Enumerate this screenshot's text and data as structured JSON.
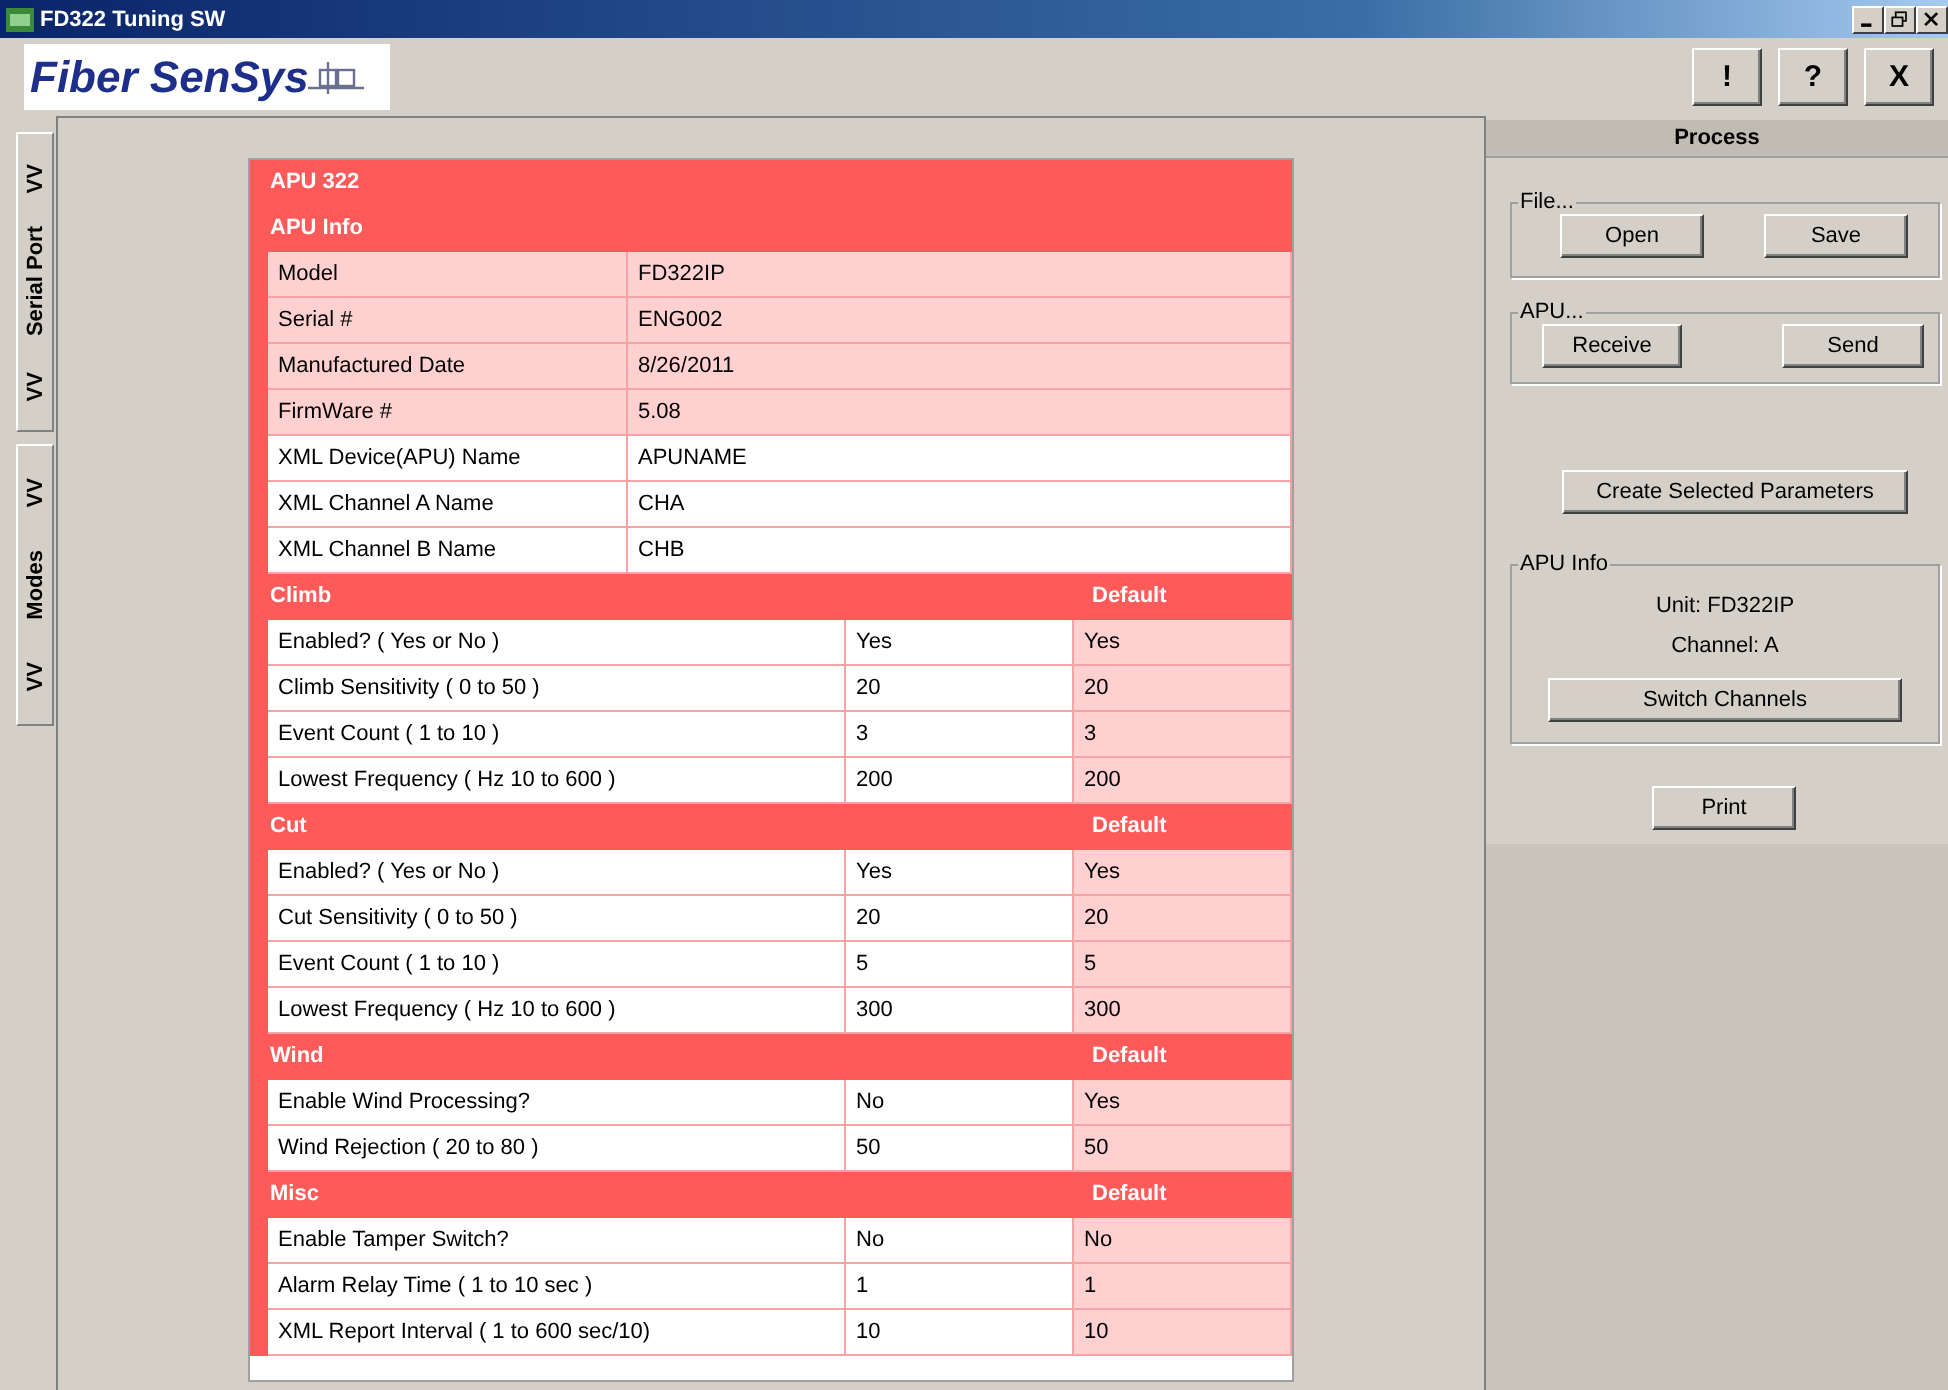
{
  "window": {
    "title": "FD322 Tuning SW"
  },
  "toolbar": {
    "logo": "Fiber SenSys",
    "buttons": [
      "!",
      "?",
      "X"
    ]
  },
  "side_tabs": [
    {
      "lead": "VV",
      "label": "Serial Port",
      "trail": "VV"
    },
    {
      "lead": "VV",
      "label": "Modes",
      "trail": "VV"
    }
  ],
  "sheet": {
    "title": "APU 322",
    "info": {
      "heading": "APU Info",
      "rows": [
        {
          "label": "Model",
          "value": "FD322IP",
          "editable": false
        },
        {
          "label": "Serial #",
          "value": "ENG002",
          "editable": false
        },
        {
          "label": "Manufactured Date",
          "value": "8/26/2011",
          "editable": false
        },
        {
          "label": "FirmWare #",
          "value": "5.08",
          "editable": false
        },
        {
          "label": "XML Device(APU) Name",
          "value": "APUNAME",
          "editable": true
        },
        {
          "label": "XML Channel A Name",
          "value": "CHA",
          "editable": true
        },
        {
          "label": "XML Channel B Name",
          "value": "CHB",
          "editable": true
        }
      ]
    },
    "sections": [
      {
        "heading": "Climb",
        "default_heading": "Default",
        "rows": [
          {
            "label": "Enabled? ( Yes or No )",
            "value": "Yes",
            "default": "Yes"
          },
          {
            "label": "Climb Sensitivity ( 0 to 50 )",
            "value": "20",
            "default": "20"
          },
          {
            "label": "Event Count ( 1 to 10 )",
            "value": "3",
            "default": "3"
          },
          {
            "label": "Lowest Frequency ( Hz 10 to 600 )",
            "value": "200",
            "default": "200"
          }
        ]
      },
      {
        "heading": "Cut",
        "default_heading": "Default",
        "rows": [
          {
            "label": "Enabled? ( Yes or No )",
            "value": "Yes",
            "default": "Yes"
          },
          {
            "label": "Cut Sensitivity ( 0 to 50 )",
            "value": "20",
            "default": "20"
          },
          {
            "label": "Event Count ( 1 to 10 )",
            "value": "5",
            "default": "5"
          },
          {
            "label": "Lowest Frequency ( Hz 10 to 600 )",
            "value": "300",
            "default": "300"
          }
        ]
      },
      {
        "heading": "Wind",
        "default_heading": "Default",
        "rows": [
          {
            "label": "Enable Wind Processing?",
            "value": "No",
            "default": "Yes"
          },
          {
            "label": "Wind Rejection ( 20 to 80 )",
            "value": "50",
            "default": "50"
          }
        ]
      },
      {
        "heading": "Misc",
        "default_heading": "Default",
        "rows": [
          {
            "label": "Enable Tamper Switch?",
            "value": "No",
            "default": "No"
          },
          {
            "label": "Alarm Relay Time ( 1 to 10 sec )",
            "value": "1",
            "default": "1"
          },
          {
            "label": "XML Report Interval ( 1 to 600 sec/10)",
            "value": "10",
            "default": "10"
          }
        ]
      }
    ]
  },
  "process": {
    "title": "Process",
    "file_group": {
      "legend": "File...",
      "buttons": [
        "Open",
        "Save"
      ]
    },
    "apu_group": {
      "legend": "APU...",
      "buttons": [
        "Receive",
        "Send"
      ]
    },
    "create_button": "Create Selected Parameters",
    "info_group": {
      "legend": "APU Info",
      "unit": "Unit: FD322IP",
      "channel": "Channel: A",
      "button": "Switch Channels"
    },
    "print_button": "Print"
  }
}
